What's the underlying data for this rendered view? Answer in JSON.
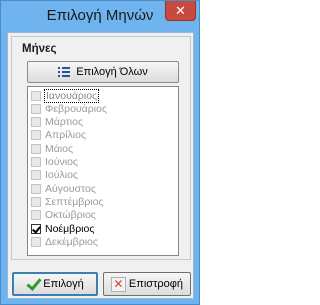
{
  "window": {
    "title": "Επιλογή Μηνών",
    "close_label": "✕"
  },
  "group": {
    "label": "Μήνες",
    "select_all_label": "Επιλογή Όλων"
  },
  "months": [
    {
      "label": "Ιανουάριος",
      "checked": false,
      "focused": true
    },
    {
      "label": "Φεβρουάριος",
      "checked": false
    },
    {
      "label": "Μάρτιος",
      "checked": false
    },
    {
      "label": "Απρίλιος",
      "checked": false
    },
    {
      "label": "Μάιος",
      "checked": false
    },
    {
      "label": "Ιούνιος",
      "checked": false
    },
    {
      "label": "Ιούλιος",
      "checked": false
    },
    {
      "label": "Αύγουστος",
      "checked": false
    },
    {
      "label": "Σεπτέμβριος",
      "checked": false
    },
    {
      "label": "Οκτώβριος",
      "checked": false
    },
    {
      "label": "Νοέμβριος",
      "checked": true
    },
    {
      "label": "Δεκέμβριος",
      "checked": false
    }
  ],
  "actions": {
    "ok_label": "Επιλογή",
    "return_label": "Επιστροφή",
    "ok_icon": "check-icon",
    "return_icon": "x-icon"
  },
  "colors": {
    "frame": "#6fb4ee",
    "close": "#c74a3f",
    "accent": "#3c7fb1"
  }
}
